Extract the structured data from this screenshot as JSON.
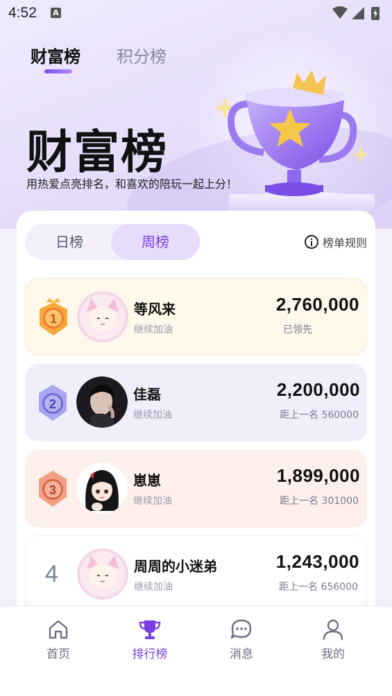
{
  "status_bar": {
    "time": "4:52",
    "notification_icon": "A"
  },
  "top_tabs": [
    {
      "label": "财富榜",
      "active": true
    },
    {
      "label": "积分榜",
      "active": false
    }
  ],
  "hero": {
    "title": "财富榜",
    "subtitle": "用热爱点亮排名，和喜欢的陪玩一起上分！",
    "image": "trophy-icon"
  },
  "period_tabs": [
    {
      "label": "日榜",
      "active": false
    },
    {
      "label": "周榜",
      "active": true
    }
  ],
  "rules_label": "榜单规则",
  "ranking": [
    {
      "rank": "1",
      "name": "等风来",
      "subtitle": "继续加油",
      "score": "2,760,000",
      "gap": "已领先",
      "medal": "gold"
    },
    {
      "rank": "2",
      "name": "佳磊",
      "subtitle": "继续加油",
      "score": "2,200,000",
      "gap": "距上一名 560000",
      "medal": "silver"
    },
    {
      "rank": "3",
      "name": "崽崽",
      "subtitle": "继续加油",
      "score": "1,899,000",
      "gap": "距上一名 301000",
      "medal": "bronze"
    },
    {
      "rank": "4",
      "name": "周周的小迷弟",
      "subtitle": "继续加油",
      "score": "1,243,000",
      "gap": "距上一名 656000",
      "medal": "none"
    }
  ],
  "bottom_nav": [
    {
      "label": "首页",
      "icon": "home-icon",
      "active": false
    },
    {
      "label": "排行榜",
      "icon": "trophy-icon",
      "active": true
    },
    {
      "label": "消息",
      "icon": "chat-icon",
      "active": false
    },
    {
      "label": "我的",
      "icon": "user-icon",
      "active": false
    }
  ],
  "colors": {
    "accent": "#7a3fe0",
    "gold": "#f2a93b",
    "silver": "#8f8ae0",
    "bronze": "#e07a5a"
  }
}
